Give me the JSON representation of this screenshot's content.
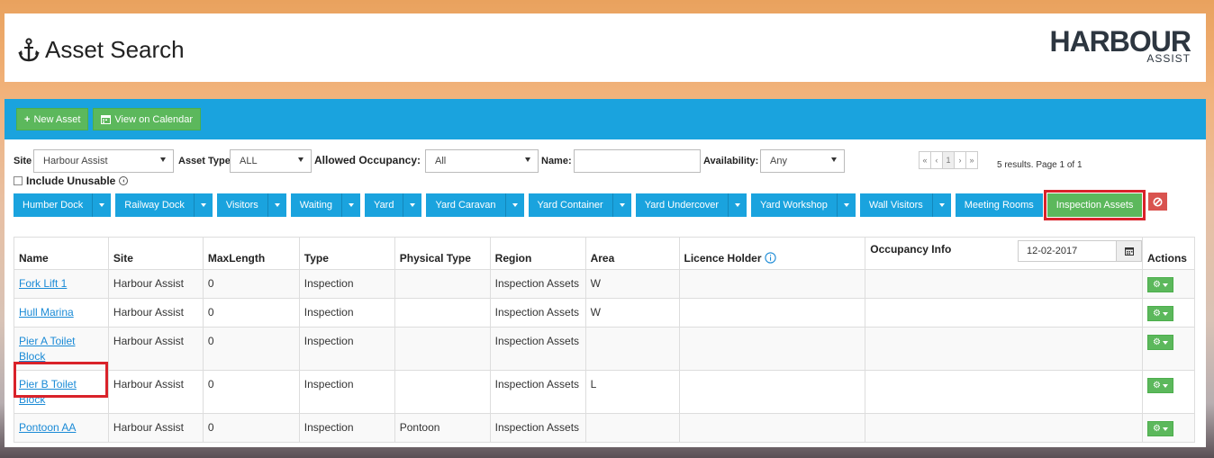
{
  "header": {
    "title": "Asset Search",
    "logo_main": "HARBOUR",
    "logo_sub": "ASSIST"
  },
  "toolbar": {
    "new_asset": "New Asset",
    "view_calendar": "View on Calendar"
  },
  "filters": {
    "site_label": "Site",
    "site_value": "Harbour Assist",
    "asset_type_label": "Asset Type",
    "asset_type_value": "ALL",
    "occupancy_label": "Allowed Occupancy:",
    "occupancy_value": "All",
    "name_label": "Name:",
    "name_value": "",
    "availability_label": "Availability:",
    "availability_value": "Any",
    "include_unusable": "Include Unusable"
  },
  "pager": {
    "first": "«",
    "prev": "‹",
    "page": "1",
    "next": "›",
    "last": "»",
    "results": "5 results. Page 1 of 1"
  },
  "tabs": [
    "Humber Dock",
    "Railway Dock",
    "Visitors",
    "Waiting",
    "Yard",
    "Yard Caravan",
    "Yard Container",
    "Yard Undercover",
    "Yard Workshop",
    "Wall Visitors",
    "Meeting Rooms",
    "Inspection Assets"
  ],
  "table": {
    "headers": [
      "Name",
      "Site",
      "MaxLength",
      "Type",
      "Physical Type",
      "Region",
      "Area",
      "Licence Holder",
      "Occupancy Info",
      "Actions"
    ],
    "date": "12-02-2017",
    "rows": [
      {
        "name": "Fork Lift 1",
        "site": "Harbour Assist",
        "maxlength": "0",
        "type": "Inspection",
        "physical": "",
        "region": "Inspection Assets",
        "area": "W"
      },
      {
        "name": "Hull Marina",
        "site": "Harbour Assist",
        "maxlength": "0",
        "type": "Inspection",
        "physical": "",
        "region": "Inspection Assets",
        "area": "W"
      },
      {
        "name": "Pier A Toilet Block",
        "site": "Harbour Assist",
        "maxlength": "0",
        "type": "Inspection",
        "physical": "",
        "region": "Inspection Assets",
        "area": ""
      },
      {
        "name": "Pier B Toilet Block",
        "site": "Harbour Assist",
        "maxlength": "0",
        "type": "Inspection",
        "physical": "",
        "region": "Inspection Assets",
        "area": "L"
      },
      {
        "name": "Pontoon AA",
        "site": "Harbour Assist",
        "maxlength": "0",
        "type": "Inspection",
        "physical": "Pontoon",
        "region": "Inspection Assets",
        "area": ""
      }
    ]
  },
  "colors": {
    "toolbar": "#1aa3de",
    "green": "#5cb85c",
    "highlight": "#d9222a",
    "link": "#1a8ad6"
  }
}
